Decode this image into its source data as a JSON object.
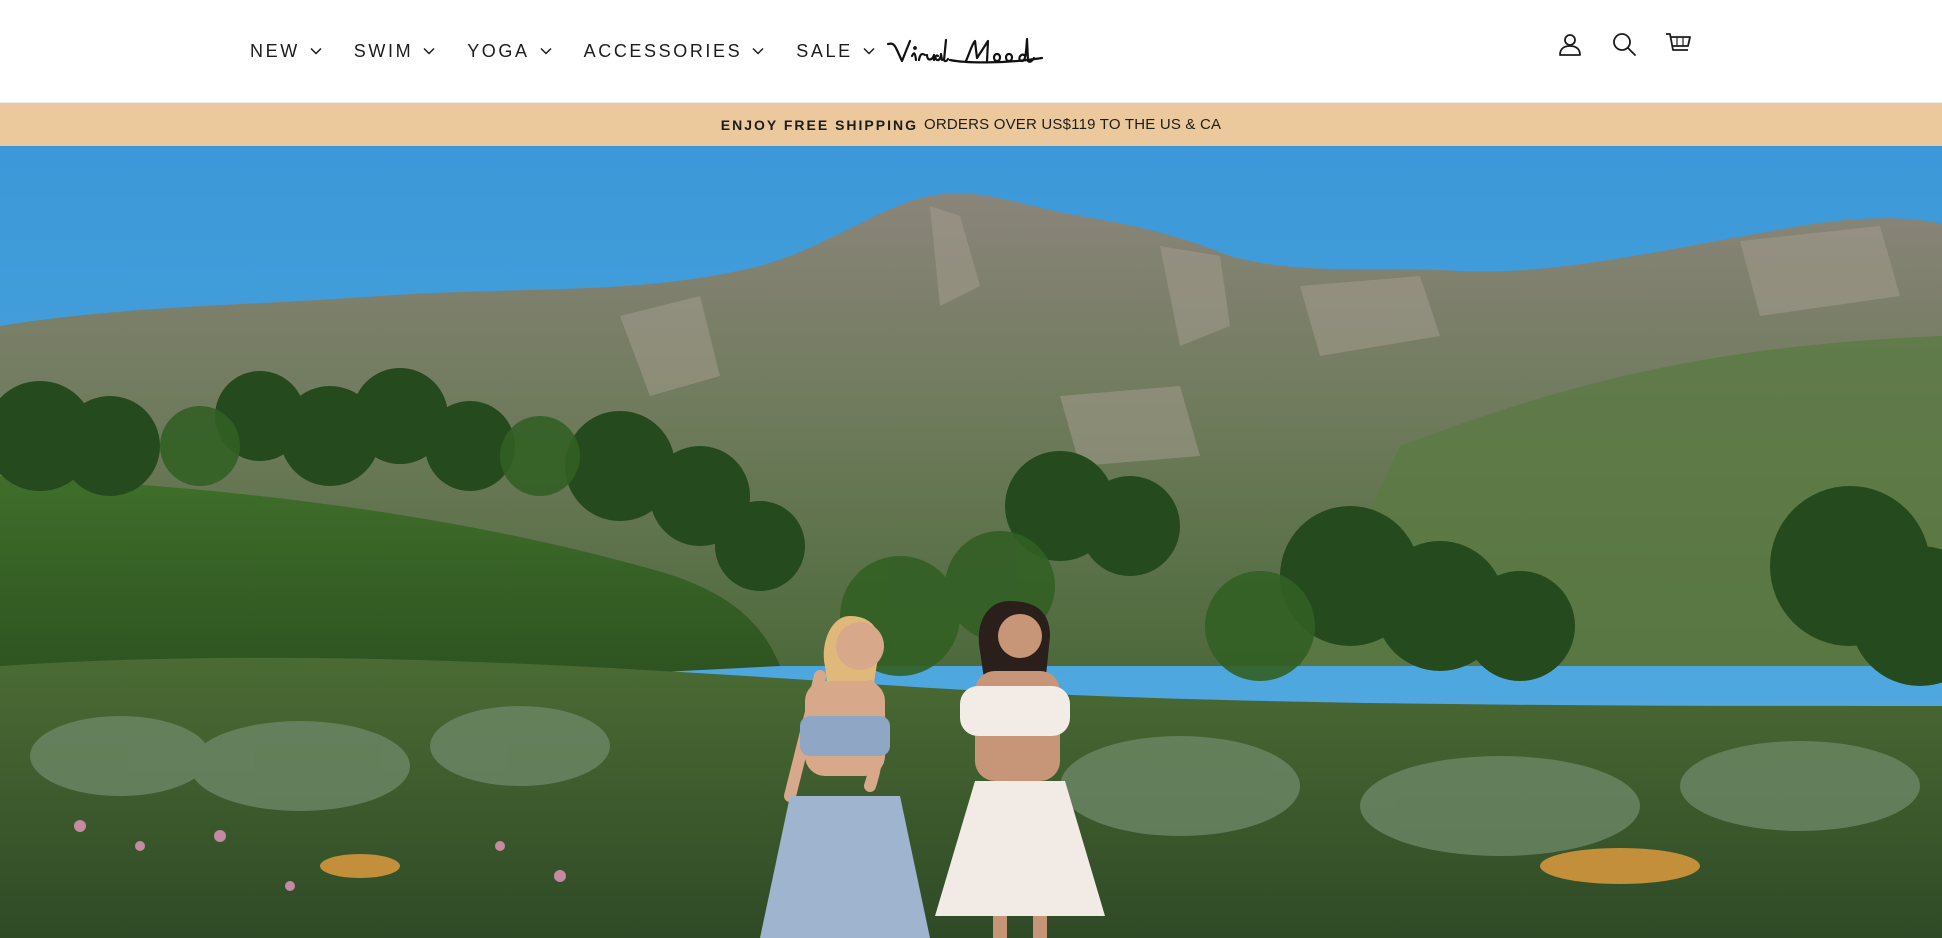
{
  "header": {
    "nav": [
      {
        "label": "NEW"
      },
      {
        "label": "SWIM"
      },
      {
        "label": "YOGA"
      },
      {
        "label": "ACCESSORIES"
      },
      {
        "label": "SALE"
      }
    ],
    "logo_text": "Virual Mood",
    "icons": {
      "account": "user-icon",
      "search": "search-icon",
      "cart": "cart-icon"
    }
  },
  "announcement": {
    "bold": "ENJOY FREE SHIPPING",
    "rest": "ORDERS OVER US$119 TO THE US & CA"
  },
  "hero": {
    "image_description_icon": "hero-landscape-image"
  },
  "colors": {
    "announcement_bg": "#ecc99c",
    "text": "#1c1c1c",
    "sky": "#3a96d6"
  }
}
